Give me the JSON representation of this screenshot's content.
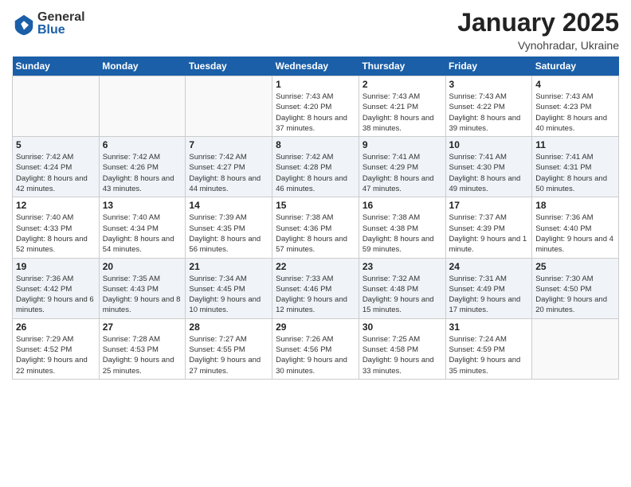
{
  "header": {
    "logo_general": "General",
    "logo_blue": "Blue",
    "title": "January 2025",
    "subtitle": "Vynohradar, Ukraine"
  },
  "days_of_week": [
    "Sunday",
    "Monday",
    "Tuesday",
    "Wednesday",
    "Thursday",
    "Friday",
    "Saturday"
  ],
  "weeks": [
    [
      {
        "day": "",
        "info": ""
      },
      {
        "day": "",
        "info": ""
      },
      {
        "day": "",
        "info": ""
      },
      {
        "day": "1",
        "info": "Sunrise: 7:43 AM\nSunset: 4:20 PM\nDaylight: 8 hours and 37 minutes."
      },
      {
        "day": "2",
        "info": "Sunrise: 7:43 AM\nSunset: 4:21 PM\nDaylight: 8 hours and 38 minutes."
      },
      {
        "day": "3",
        "info": "Sunrise: 7:43 AM\nSunset: 4:22 PM\nDaylight: 8 hours and 39 minutes."
      },
      {
        "day": "4",
        "info": "Sunrise: 7:43 AM\nSunset: 4:23 PM\nDaylight: 8 hours and 40 minutes."
      }
    ],
    [
      {
        "day": "5",
        "info": "Sunrise: 7:42 AM\nSunset: 4:24 PM\nDaylight: 8 hours and 42 minutes."
      },
      {
        "day": "6",
        "info": "Sunrise: 7:42 AM\nSunset: 4:26 PM\nDaylight: 8 hours and 43 minutes."
      },
      {
        "day": "7",
        "info": "Sunrise: 7:42 AM\nSunset: 4:27 PM\nDaylight: 8 hours and 44 minutes."
      },
      {
        "day": "8",
        "info": "Sunrise: 7:42 AM\nSunset: 4:28 PM\nDaylight: 8 hours and 46 minutes."
      },
      {
        "day": "9",
        "info": "Sunrise: 7:41 AM\nSunset: 4:29 PM\nDaylight: 8 hours and 47 minutes."
      },
      {
        "day": "10",
        "info": "Sunrise: 7:41 AM\nSunset: 4:30 PM\nDaylight: 8 hours and 49 minutes."
      },
      {
        "day": "11",
        "info": "Sunrise: 7:41 AM\nSunset: 4:31 PM\nDaylight: 8 hours and 50 minutes."
      }
    ],
    [
      {
        "day": "12",
        "info": "Sunrise: 7:40 AM\nSunset: 4:33 PM\nDaylight: 8 hours and 52 minutes."
      },
      {
        "day": "13",
        "info": "Sunrise: 7:40 AM\nSunset: 4:34 PM\nDaylight: 8 hours and 54 minutes."
      },
      {
        "day": "14",
        "info": "Sunrise: 7:39 AM\nSunset: 4:35 PM\nDaylight: 8 hours and 56 minutes."
      },
      {
        "day": "15",
        "info": "Sunrise: 7:38 AM\nSunset: 4:36 PM\nDaylight: 8 hours and 57 minutes."
      },
      {
        "day": "16",
        "info": "Sunrise: 7:38 AM\nSunset: 4:38 PM\nDaylight: 8 hours and 59 minutes."
      },
      {
        "day": "17",
        "info": "Sunrise: 7:37 AM\nSunset: 4:39 PM\nDaylight: 9 hours and 1 minute."
      },
      {
        "day": "18",
        "info": "Sunrise: 7:36 AM\nSunset: 4:40 PM\nDaylight: 9 hours and 4 minutes."
      }
    ],
    [
      {
        "day": "19",
        "info": "Sunrise: 7:36 AM\nSunset: 4:42 PM\nDaylight: 9 hours and 6 minutes."
      },
      {
        "day": "20",
        "info": "Sunrise: 7:35 AM\nSunset: 4:43 PM\nDaylight: 9 hours and 8 minutes."
      },
      {
        "day": "21",
        "info": "Sunrise: 7:34 AM\nSunset: 4:45 PM\nDaylight: 9 hours and 10 minutes."
      },
      {
        "day": "22",
        "info": "Sunrise: 7:33 AM\nSunset: 4:46 PM\nDaylight: 9 hours and 12 minutes."
      },
      {
        "day": "23",
        "info": "Sunrise: 7:32 AM\nSunset: 4:48 PM\nDaylight: 9 hours and 15 minutes."
      },
      {
        "day": "24",
        "info": "Sunrise: 7:31 AM\nSunset: 4:49 PM\nDaylight: 9 hours and 17 minutes."
      },
      {
        "day": "25",
        "info": "Sunrise: 7:30 AM\nSunset: 4:50 PM\nDaylight: 9 hours and 20 minutes."
      }
    ],
    [
      {
        "day": "26",
        "info": "Sunrise: 7:29 AM\nSunset: 4:52 PM\nDaylight: 9 hours and 22 minutes."
      },
      {
        "day": "27",
        "info": "Sunrise: 7:28 AM\nSunset: 4:53 PM\nDaylight: 9 hours and 25 minutes."
      },
      {
        "day": "28",
        "info": "Sunrise: 7:27 AM\nSunset: 4:55 PM\nDaylight: 9 hours and 27 minutes."
      },
      {
        "day": "29",
        "info": "Sunrise: 7:26 AM\nSunset: 4:56 PM\nDaylight: 9 hours and 30 minutes."
      },
      {
        "day": "30",
        "info": "Sunrise: 7:25 AM\nSunset: 4:58 PM\nDaylight: 9 hours and 33 minutes."
      },
      {
        "day": "31",
        "info": "Sunrise: 7:24 AM\nSunset: 4:59 PM\nDaylight: 9 hours and 35 minutes."
      },
      {
        "day": "",
        "info": ""
      }
    ]
  ]
}
